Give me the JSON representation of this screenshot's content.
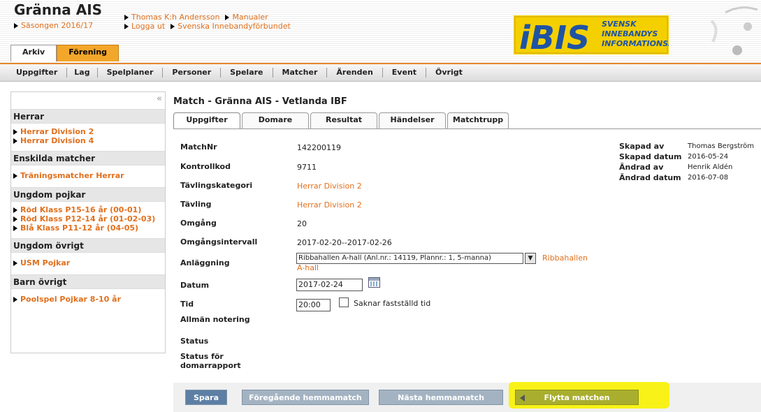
{
  "header": {
    "club_name": "Gränna AIS",
    "season": "Säsongen 2016/17",
    "user": "Thomas K:h Andersson",
    "manuals": "Manualer",
    "logout": "Logga ut",
    "federation": "Svenska Innebandyförbundet",
    "tabs": [
      "Arkiv",
      "Förening"
    ],
    "logo_text": "iBIS",
    "logo_sub": [
      "SVENSK",
      "INNEBANDYS",
      "INFORMATIONSSYSTEM"
    ]
  },
  "nav": [
    "Uppgifter",
    "Lag",
    "Spelplaner",
    "Personer",
    "Spelare",
    "Matcher",
    "Ärenden",
    "Event",
    "Övrigt"
  ],
  "sidebar": {
    "collapse": "«",
    "sections": [
      {
        "title": "Herrar",
        "items": [
          "Herrar Division 2",
          "Herrar Division 4"
        ]
      },
      {
        "title": "Enskilda matcher",
        "items": [
          "Träningsmatcher Herrar"
        ]
      },
      {
        "title": "Ungdom pojkar",
        "items": [
          "Röd Klass P15-16 år (00-01)",
          "Röd Klass P12-14 år (01-02-03)",
          "Blå Klass P11-12 år (04-05)"
        ]
      },
      {
        "title": "Ungdom övrigt",
        "items": [
          "USM Pojkar"
        ]
      },
      {
        "title": "Barn övrigt",
        "items": [
          "Poolspel Pojkar 8-10 år"
        ]
      }
    ]
  },
  "main": {
    "title": "Match - Gränna AIS - Vetlanda IBF",
    "tabs": [
      "Uppgifter",
      "Domare",
      "Resultat",
      "Händelser",
      "Matchtrupp"
    ],
    "fields": {
      "matchnr_label": "MatchNr",
      "matchnr": "142200119",
      "kontrollkod_label": "Kontrollkod",
      "kontrollkod": "9711",
      "kategori_label": "Tävlingskategori",
      "kategori": "Herrar Division 2",
      "tavling_label": "Tävling",
      "tavling": "Herrar Division 2",
      "omgang_label": "Omgång",
      "omgang": "20",
      "intervall_label": "Omgångsintervall",
      "intervall": "2017-02-20--2017-02-26",
      "anlaggning_label": "Anläggning",
      "anlaggning_select": "Ribbahallen A-hall (Anl.nr.: 14119, Plannr.: 1, 5-manna)",
      "anlaggning_link1": "Ribbahallen",
      "anlaggning_link2": "A-hall",
      "datum_label": "Datum",
      "datum": "2017-02-24",
      "tid_label": "Tid",
      "tid": "20:00",
      "saknar_tid": "Saknar fastställd tid",
      "notering_label": "Allmän notering",
      "status_label": "Status",
      "domarrapport_label1": "Status för",
      "domarrapport_label2": "domarrapport"
    },
    "meta": {
      "skapad_av_label": "Skapad av",
      "skapad_av": "Thomas Bergström",
      "skapad_datum_label": "Skapad datum",
      "skapad_datum": "2016-05-24",
      "andrad_av_label": "Ändrad av",
      "andrad_av": "Henrik Aldén",
      "andrad_datum_label": "Ändrad datum",
      "andrad_datum": "2016-07-08"
    },
    "buttons": {
      "save": "Spara",
      "prev": "Föregående hemmamatch",
      "next": "Nästa hemmamatch",
      "move": "Flytta matchen"
    }
  },
  "colors": {
    "accent": "#e0701e",
    "tab_active": "#f3a72a",
    "highlight": "#f8f200",
    "logo_yellow": "#f5d000"
  }
}
